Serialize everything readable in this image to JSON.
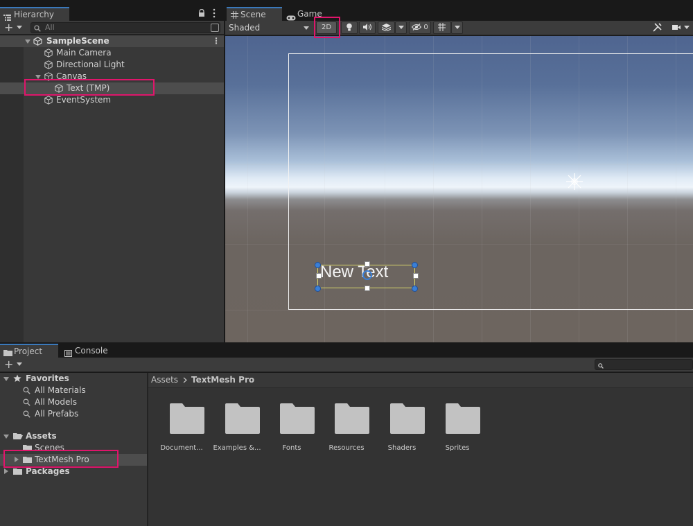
{
  "hierarchy": {
    "tab_label": "Hierarchy",
    "search_placeholder": "All",
    "scene_name": "SampleScene",
    "items": [
      {
        "label": "Main Camera"
      },
      {
        "label": "Directional Light"
      },
      {
        "label": "Canvas"
      },
      {
        "label": "Text (TMP)"
      },
      {
        "label": "EventSystem"
      }
    ]
  },
  "scene_view": {
    "scene_tab": "Scene",
    "game_tab": "Game",
    "shading_mode": "Shaded",
    "mode_2d": "2D",
    "hidden_count": "0",
    "text_object": "New Text"
  },
  "project": {
    "project_tab": "Project",
    "console_tab": "Console",
    "favorites_label": "Favorites",
    "favorites": [
      "All Materials",
      "All Models",
      "All Prefabs"
    ],
    "assets_label": "Assets",
    "asset_folders": [
      "Scenes",
      "TextMesh Pro"
    ],
    "packages_label": "Packages",
    "breadcrumb": [
      "Assets",
      "TextMesh Pro"
    ],
    "folders": [
      "Document...",
      "Examples &...",
      "Fonts",
      "Resources",
      "Shaders",
      "Sprites"
    ]
  },
  "colors": {
    "highlight": "#e0156b",
    "tab_accent": "#3a79bb",
    "selection_handle": "#3a7fd6"
  }
}
